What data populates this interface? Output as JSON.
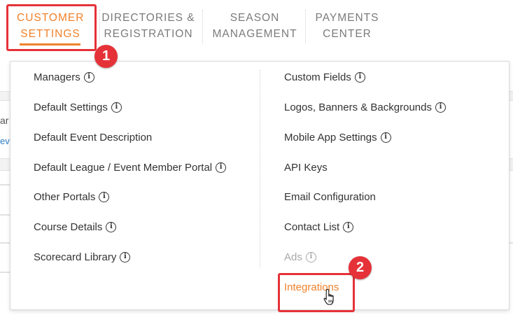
{
  "nav": {
    "tabs": [
      {
        "line1": "CUSTOMER",
        "line2": "SETTINGS"
      },
      {
        "line1": "DIRECTORIES &",
        "line2": "REGISTRATION"
      },
      {
        "line1": "SEASON",
        "line2": "MANAGEMENT"
      },
      {
        "line1": "PAYMENTS",
        "line2": "CENTER"
      }
    ],
    "active_index": 0
  },
  "dropdown": {
    "left_items": [
      {
        "label": "Managers",
        "info": true
      },
      {
        "label": "Default Settings",
        "info": true
      },
      {
        "label": "Default Event Description",
        "info": false
      },
      {
        "label": "Default League / Event Member Portal",
        "info": true
      },
      {
        "label": "Other Portals",
        "info": true
      },
      {
        "label": "Course Details",
        "info": true
      },
      {
        "label": "Scorecard Library",
        "info": true
      }
    ],
    "right_items": [
      {
        "label": "Custom Fields",
        "info": true
      },
      {
        "label": "Logos, Banners & Backgrounds",
        "info": true
      },
      {
        "label": "Mobile App Settings",
        "info": true
      },
      {
        "label": "API Keys",
        "info": false
      },
      {
        "label": "Email Configuration",
        "info": false
      },
      {
        "label": "Contact List",
        "info": true
      },
      {
        "label": "Ads",
        "info": true,
        "disabled": true
      },
      {
        "label": "Integrations",
        "info": false,
        "highlighted": true
      }
    ]
  },
  "annotations": {
    "step1": "1",
    "step2": "2"
  },
  "background": {
    "fragment1": "ar",
    "fragment2": "ev"
  },
  "colors": {
    "accent": "#f0822b",
    "annotation": "#e53238",
    "text": "#333333",
    "muted": "#7b7b7b",
    "disabled": "#a8a8a8"
  },
  "icons": {
    "info": "info-circle-icon",
    "cursor": "hand-pointer-icon"
  }
}
